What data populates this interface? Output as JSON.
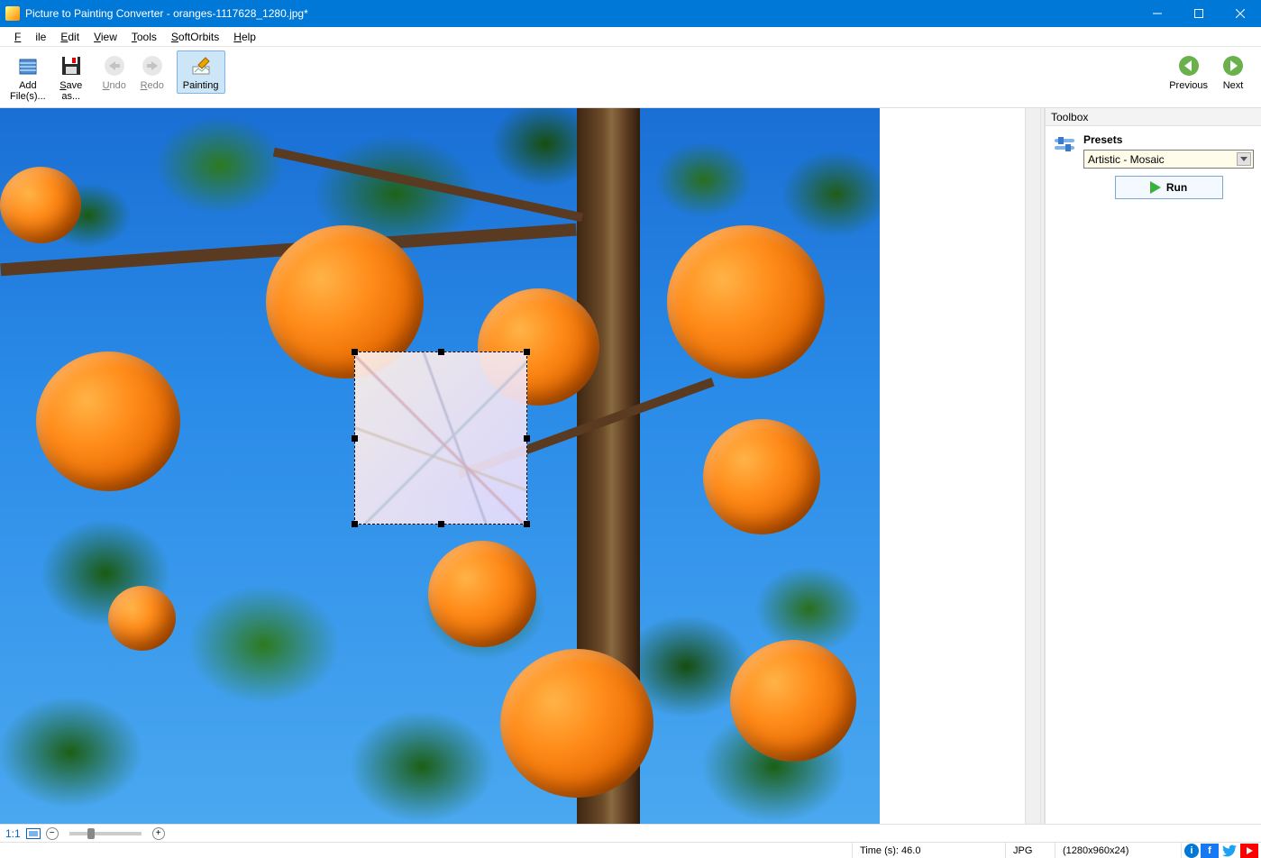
{
  "titlebar": {
    "text": "Picture to Painting Converter - oranges-1117628_1280.jpg*"
  },
  "menubar": {
    "file": "File",
    "edit": "Edit",
    "view": "View",
    "tools": "Tools",
    "softorbits": "SoftOrbits",
    "help": "Help"
  },
  "toolbar": {
    "add_files": "Add\nFile(s)...",
    "save_as": "Save\nas...",
    "undo": "Undo",
    "redo": "Redo",
    "painting": "Painting",
    "previous": "Previous",
    "next": "Next"
  },
  "toolbox": {
    "header": "Toolbox",
    "presets_label": "Presets",
    "preset_selected": "Artistic - Mosaic",
    "run": "Run"
  },
  "zoombar": {
    "ratio": "1:1"
  },
  "statusbar": {
    "time": "Time (s): 46.0",
    "format": "JPG",
    "dimensions": "(1280x960x24)"
  }
}
